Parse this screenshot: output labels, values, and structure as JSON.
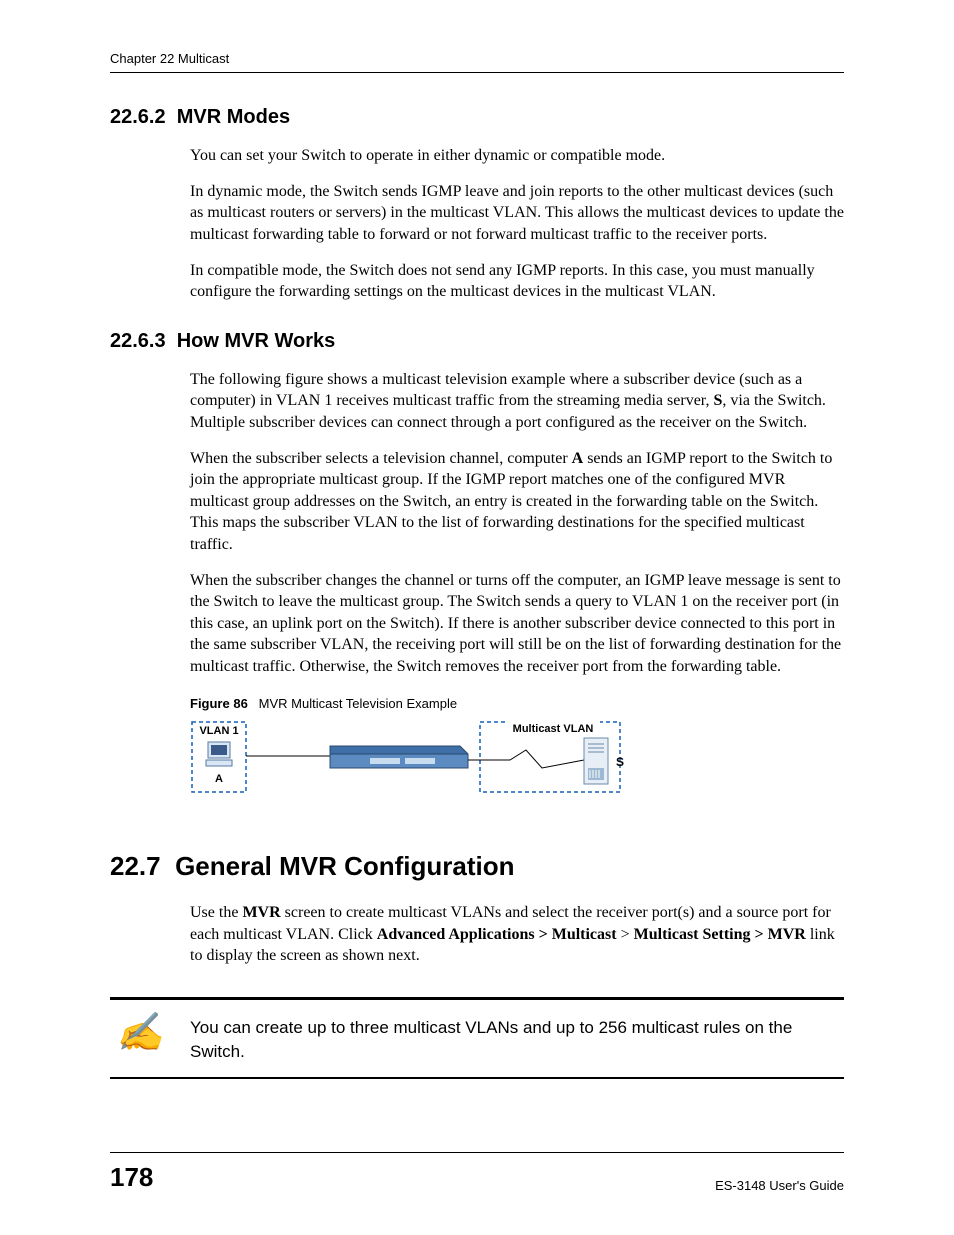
{
  "header": {
    "chapter_label": "Chapter 22 Multicast"
  },
  "sections": {
    "s1": {
      "number": "22.6.2",
      "title": "MVR Modes",
      "p1": "You can set your Switch to operate in either dynamic or compatible mode.",
      "p2": "In dynamic mode, the Switch sends IGMP leave and join reports to the other multicast devices (such as multicast routers or servers) in the multicast VLAN. This allows the multicast devices to update the multicast forwarding table to forward or not forward multicast traffic to the receiver ports.",
      "p3": "In compatible mode, the Switch does not send any IGMP reports. In this case, you must manually configure the forwarding settings on the multicast devices in the multicast VLAN."
    },
    "s2": {
      "number": "22.6.3",
      "title": "How MVR Works",
      "p1_a": "The following figure shows a multicast television example where a subscriber device (such as a computer) in VLAN 1 receives multicast traffic from the streaming media server, ",
      "p1_bold": "S",
      "p1_b": ", via the Switch. Multiple subscriber devices can connect through a port configured as the receiver on the Switch.",
      "p2_a": "When the subscriber selects a television channel, computer ",
      "p2_bold": "A",
      "p2_b": " sends an IGMP report to the Switch to join the appropriate multicast group. If the IGMP report matches one of the configured MVR multicast group addresses on the Switch, an entry is created in the forwarding table on the Switch. This maps the subscriber VLAN to the list of forwarding destinations for the specified multicast traffic.",
      "p3": "When the subscriber changes the channel or turns off the computer, an IGMP leave message is sent to the Switch to leave the multicast group. The Switch sends a query to VLAN 1 on the receiver port (in this case, an uplink port on the Switch). If there is another subscriber device connected to this port in the same subscriber VLAN, the receiving port will still be on the list of forwarding destination for the multicast traffic. Otherwise, the Switch removes the receiver port from the forwarding table."
    },
    "figure": {
      "label": "Figure 86",
      "caption": "MVR Multicast Television Example",
      "vlan1_label": "VLAN 1",
      "a_label": "A",
      "mvlan_label": "Multicast VLAN",
      "s_label": "S"
    },
    "s3": {
      "number": "22.7",
      "title": "General MVR Configuration",
      "p1_a": "Use the ",
      "p1_bold1": "MVR",
      "p1_b": " screen to create multicast VLANs and select the receiver port(s) and a source port for each multicast VLAN. Click ",
      "p1_bold2": "Advanced Applications > Multicast",
      "p1_c": " > ",
      "p1_bold3": "Multicast Setting > MVR",
      "p1_d": " link to display the screen as shown next."
    },
    "note": {
      "text": "You can create up to three multicast VLANs and up to 256 multicast rules on the Switch."
    }
  },
  "footer": {
    "page_number": "178",
    "guide": "ES-3148 User's Guide"
  }
}
